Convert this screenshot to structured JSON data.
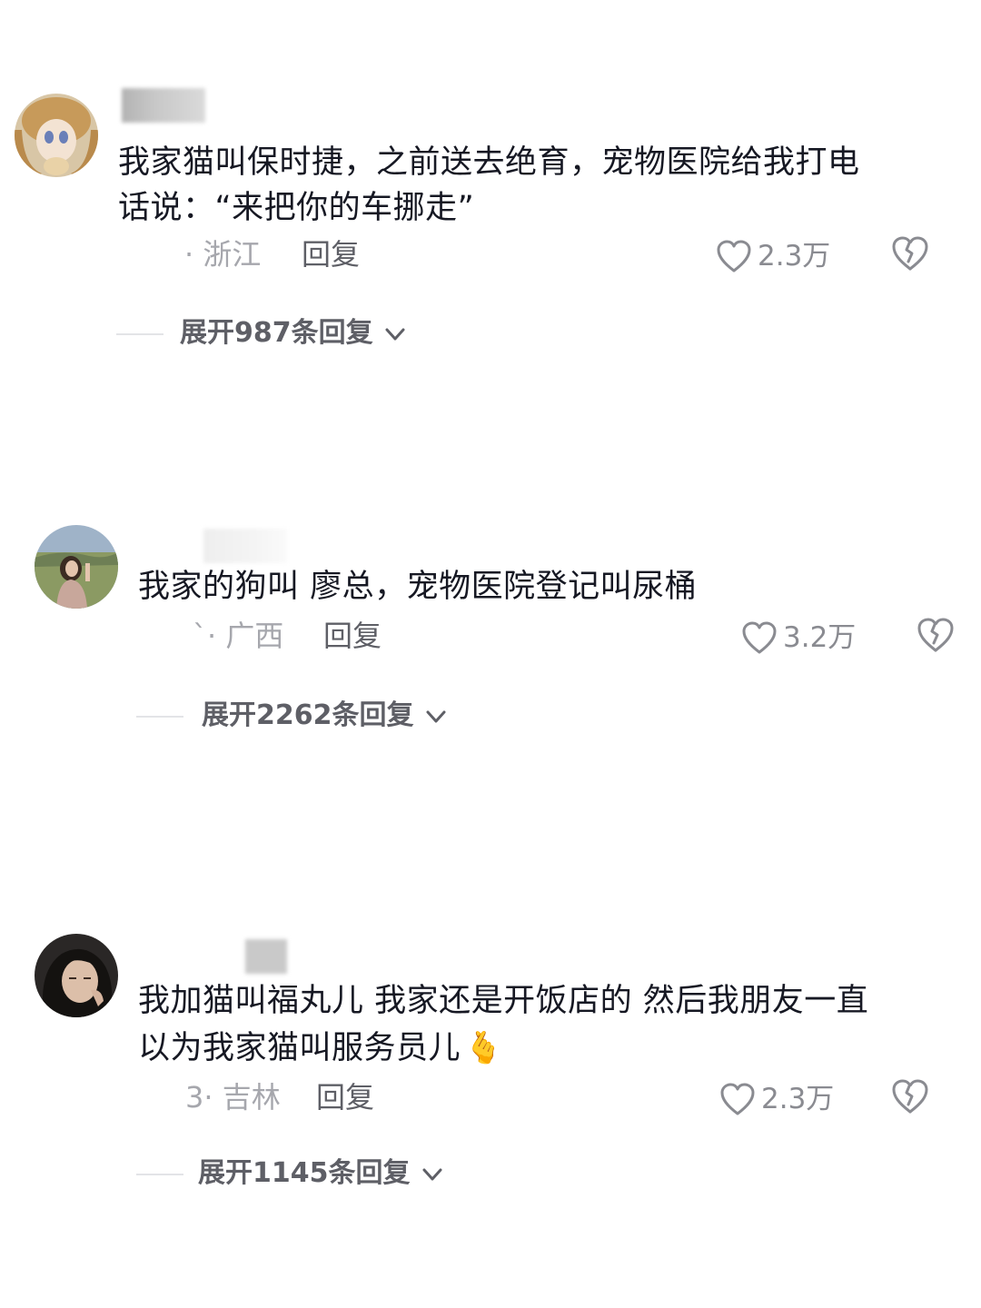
{
  "comments": [
    {
      "text_lines": [
        "我家猫叫保时捷，之前送去绝育，宠物医院给我打电",
        "话说：“来把你的车挪走”"
      ],
      "location": "· 浙江",
      "reply_label": "回复",
      "likes": "2.3万",
      "expand_label": "展开987条回复"
    },
    {
      "text_lines": [
        "我家的狗叫 廖总，宠物医院登记叫尿桶"
      ],
      "location": "`· 广西",
      "reply_label": "回复",
      "likes": "3.2万",
      "expand_label": "展开2262条回复"
    },
    {
      "text_lines": [
        "我加猫叫福丸儿 我家还是开饭店的  然后我朋友一直",
        "以为我家猫叫服务员儿"
      ],
      "emoji": "🫰",
      "location": "3· 吉林",
      "reply_label": "回复",
      "likes": "2.3万",
      "expand_label": "展开1145条回复"
    }
  ],
  "icons": {
    "like": "heart-outline-icon",
    "dislike": "broken-heart-icon",
    "expand": "chevron-down-icon"
  },
  "colors": {
    "text": "#161823",
    "meta": "#a6a7ad",
    "secondary": "#5e5f66"
  }
}
